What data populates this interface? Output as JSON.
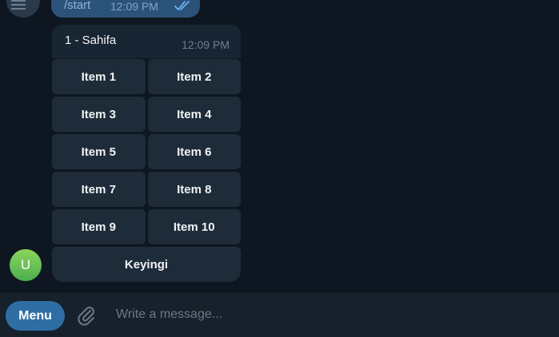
{
  "outgoing": {
    "command": "/start",
    "time": "12:09 PM"
  },
  "bot_message": {
    "text": "1 - Sahifa",
    "time": "12:09 PM"
  },
  "keyboard": {
    "rows": [
      [
        "Item 1",
        "Item 2"
      ],
      [
        "Item 3",
        "Item 4"
      ],
      [
        "Item 5",
        "Item 6"
      ],
      [
        "Item 7",
        "Item 8"
      ],
      [
        "Item 9",
        "Item 10"
      ]
    ],
    "next_label": "Keyingi"
  },
  "bot_avatar": {
    "letter": "U"
  },
  "input_bar": {
    "menu_label": "Menu",
    "placeholder": "Write a message..."
  },
  "colors": {
    "background": "#0e1621",
    "outgoing_bubble": "#2b5278",
    "incoming_bubble": "#182533",
    "keyboard_button": "#1e2c3a",
    "menu_button": "#2f6ea5",
    "input_bar": "#17212b"
  }
}
